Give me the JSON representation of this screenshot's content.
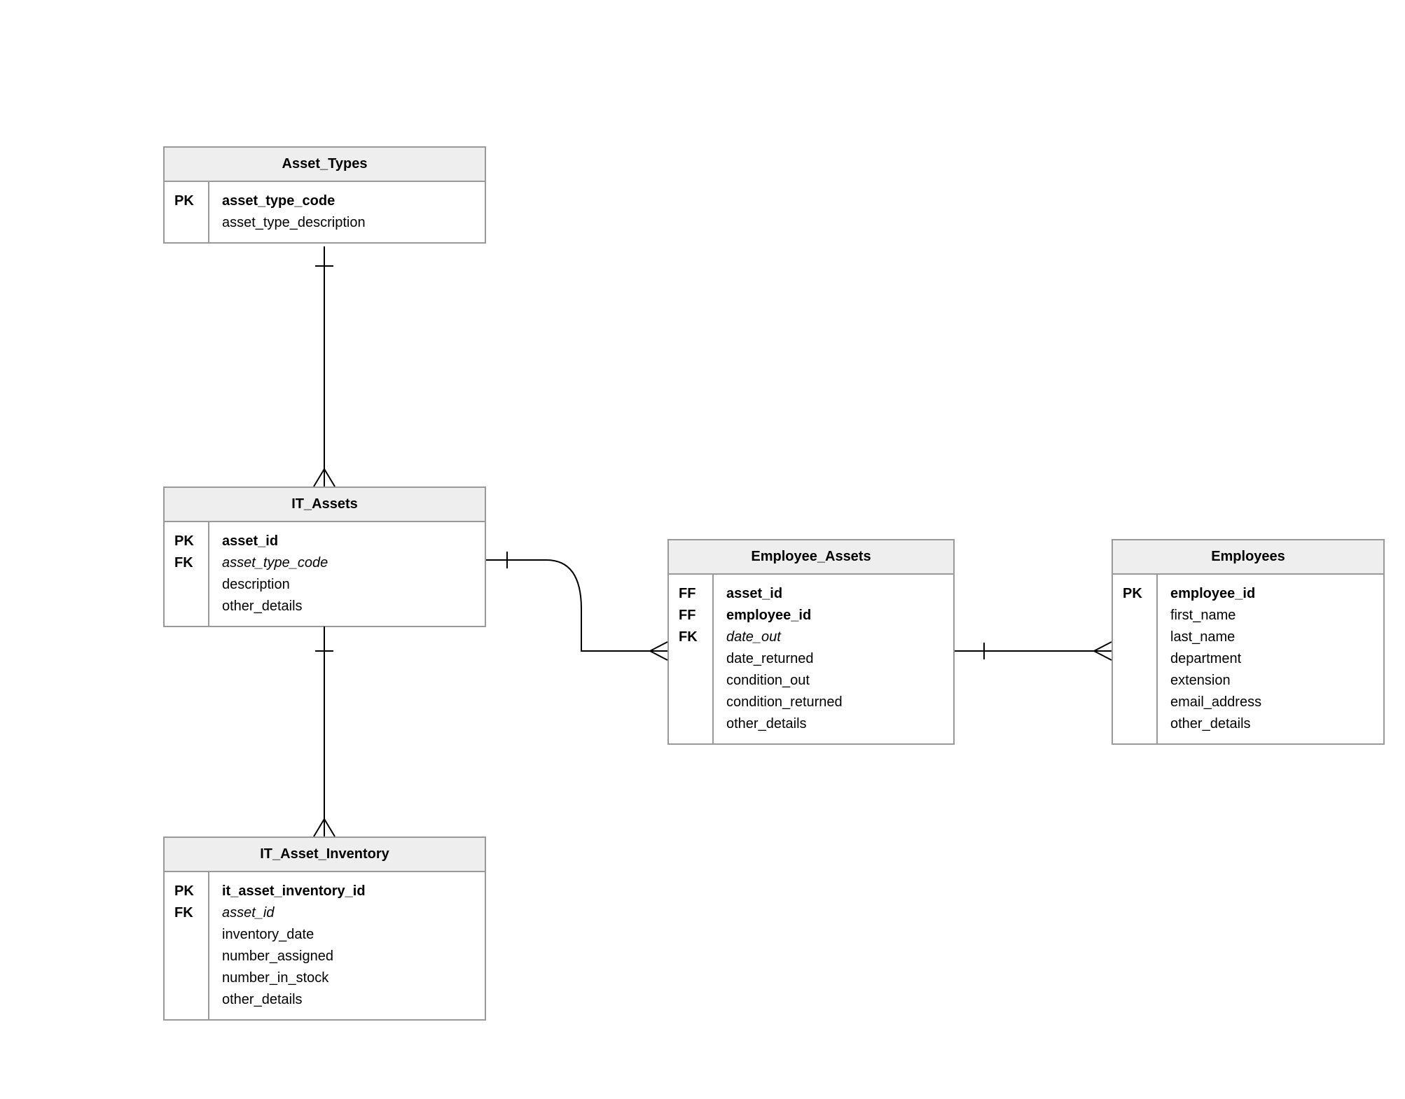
{
  "entities": {
    "asset_types": {
      "title": "Asset_Types",
      "keys": [
        "PK",
        ""
      ],
      "attrs": [
        {
          "text": "asset_type_code",
          "bold": true
        },
        {
          "text": "asset_type_description"
        }
      ]
    },
    "it_assets": {
      "title": "IT_Assets",
      "keys": [
        "PK",
        "FK",
        "",
        ""
      ],
      "attrs": [
        {
          "text": "asset_id",
          "bold": true
        },
        {
          "text": "asset_type_code",
          "italic": true
        },
        {
          "text": "description"
        },
        {
          "text": "other_details"
        }
      ]
    },
    "employee_assets": {
      "title": "Employee_Assets",
      "keys": [
        "FF",
        "FF",
        "FK",
        "",
        "",
        "",
        ""
      ],
      "attrs": [
        {
          "text": "asset_id",
          "bold": true
        },
        {
          "text": "employee_id",
          "bold": true
        },
        {
          "text": "date_out",
          "italic": true
        },
        {
          "text": "date_returned"
        },
        {
          "text": "condition_out"
        },
        {
          "text": "condition_returned"
        },
        {
          "text": "other_details"
        }
      ]
    },
    "employees": {
      "title": "Employees",
      "keys": [
        "PK",
        "",
        "",
        "",
        "",
        "",
        ""
      ],
      "attrs": [
        {
          "text": "employee_id",
          "bold": true
        },
        {
          "text": "first_name"
        },
        {
          "text": "last_name"
        },
        {
          "text": "department"
        },
        {
          "text": "extension"
        },
        {
          "text": "email_address"
        },
        {
          "text": "other_details"
        }
      ]
    },
    "it_asset_inventory": {
      "title": "IT_Asset_Inventory",
      "keys": [
        "PK",
        "FK",
        "",
        "",
        "",
        ""
      ],
      "attrs": [
        {
          "text": "it_asset_inventory_id",
          "bold": true
        },
        {
          "text": "asset_id",
          "italic": true
        },
        {
          "text": "inventory_date"
        },
        {
          "text": "number_assigned"
        },
        {
          "text": "number_in_stock"
        },
        {
          "text": "other_details"
        }
      ]
    }
  },
  "relationships": [
    {
      "from": "Asset_Types",
      "to": "IT_Assets",
      "type": "one-to-many"
    },
    {
      "from": "IT_Assets",
      "to": "IT_Asset_Inventory",
      "type": "one-to-many"
    },
    {
      "from": "IT_Assets",
      "to": "Employee_Assets",
      "type": "one-to-many"
    },
    {
      "from": "Employees",
      "to": "Employee_Assets",
      "type": "one-to-many"
    }
  ]
}
